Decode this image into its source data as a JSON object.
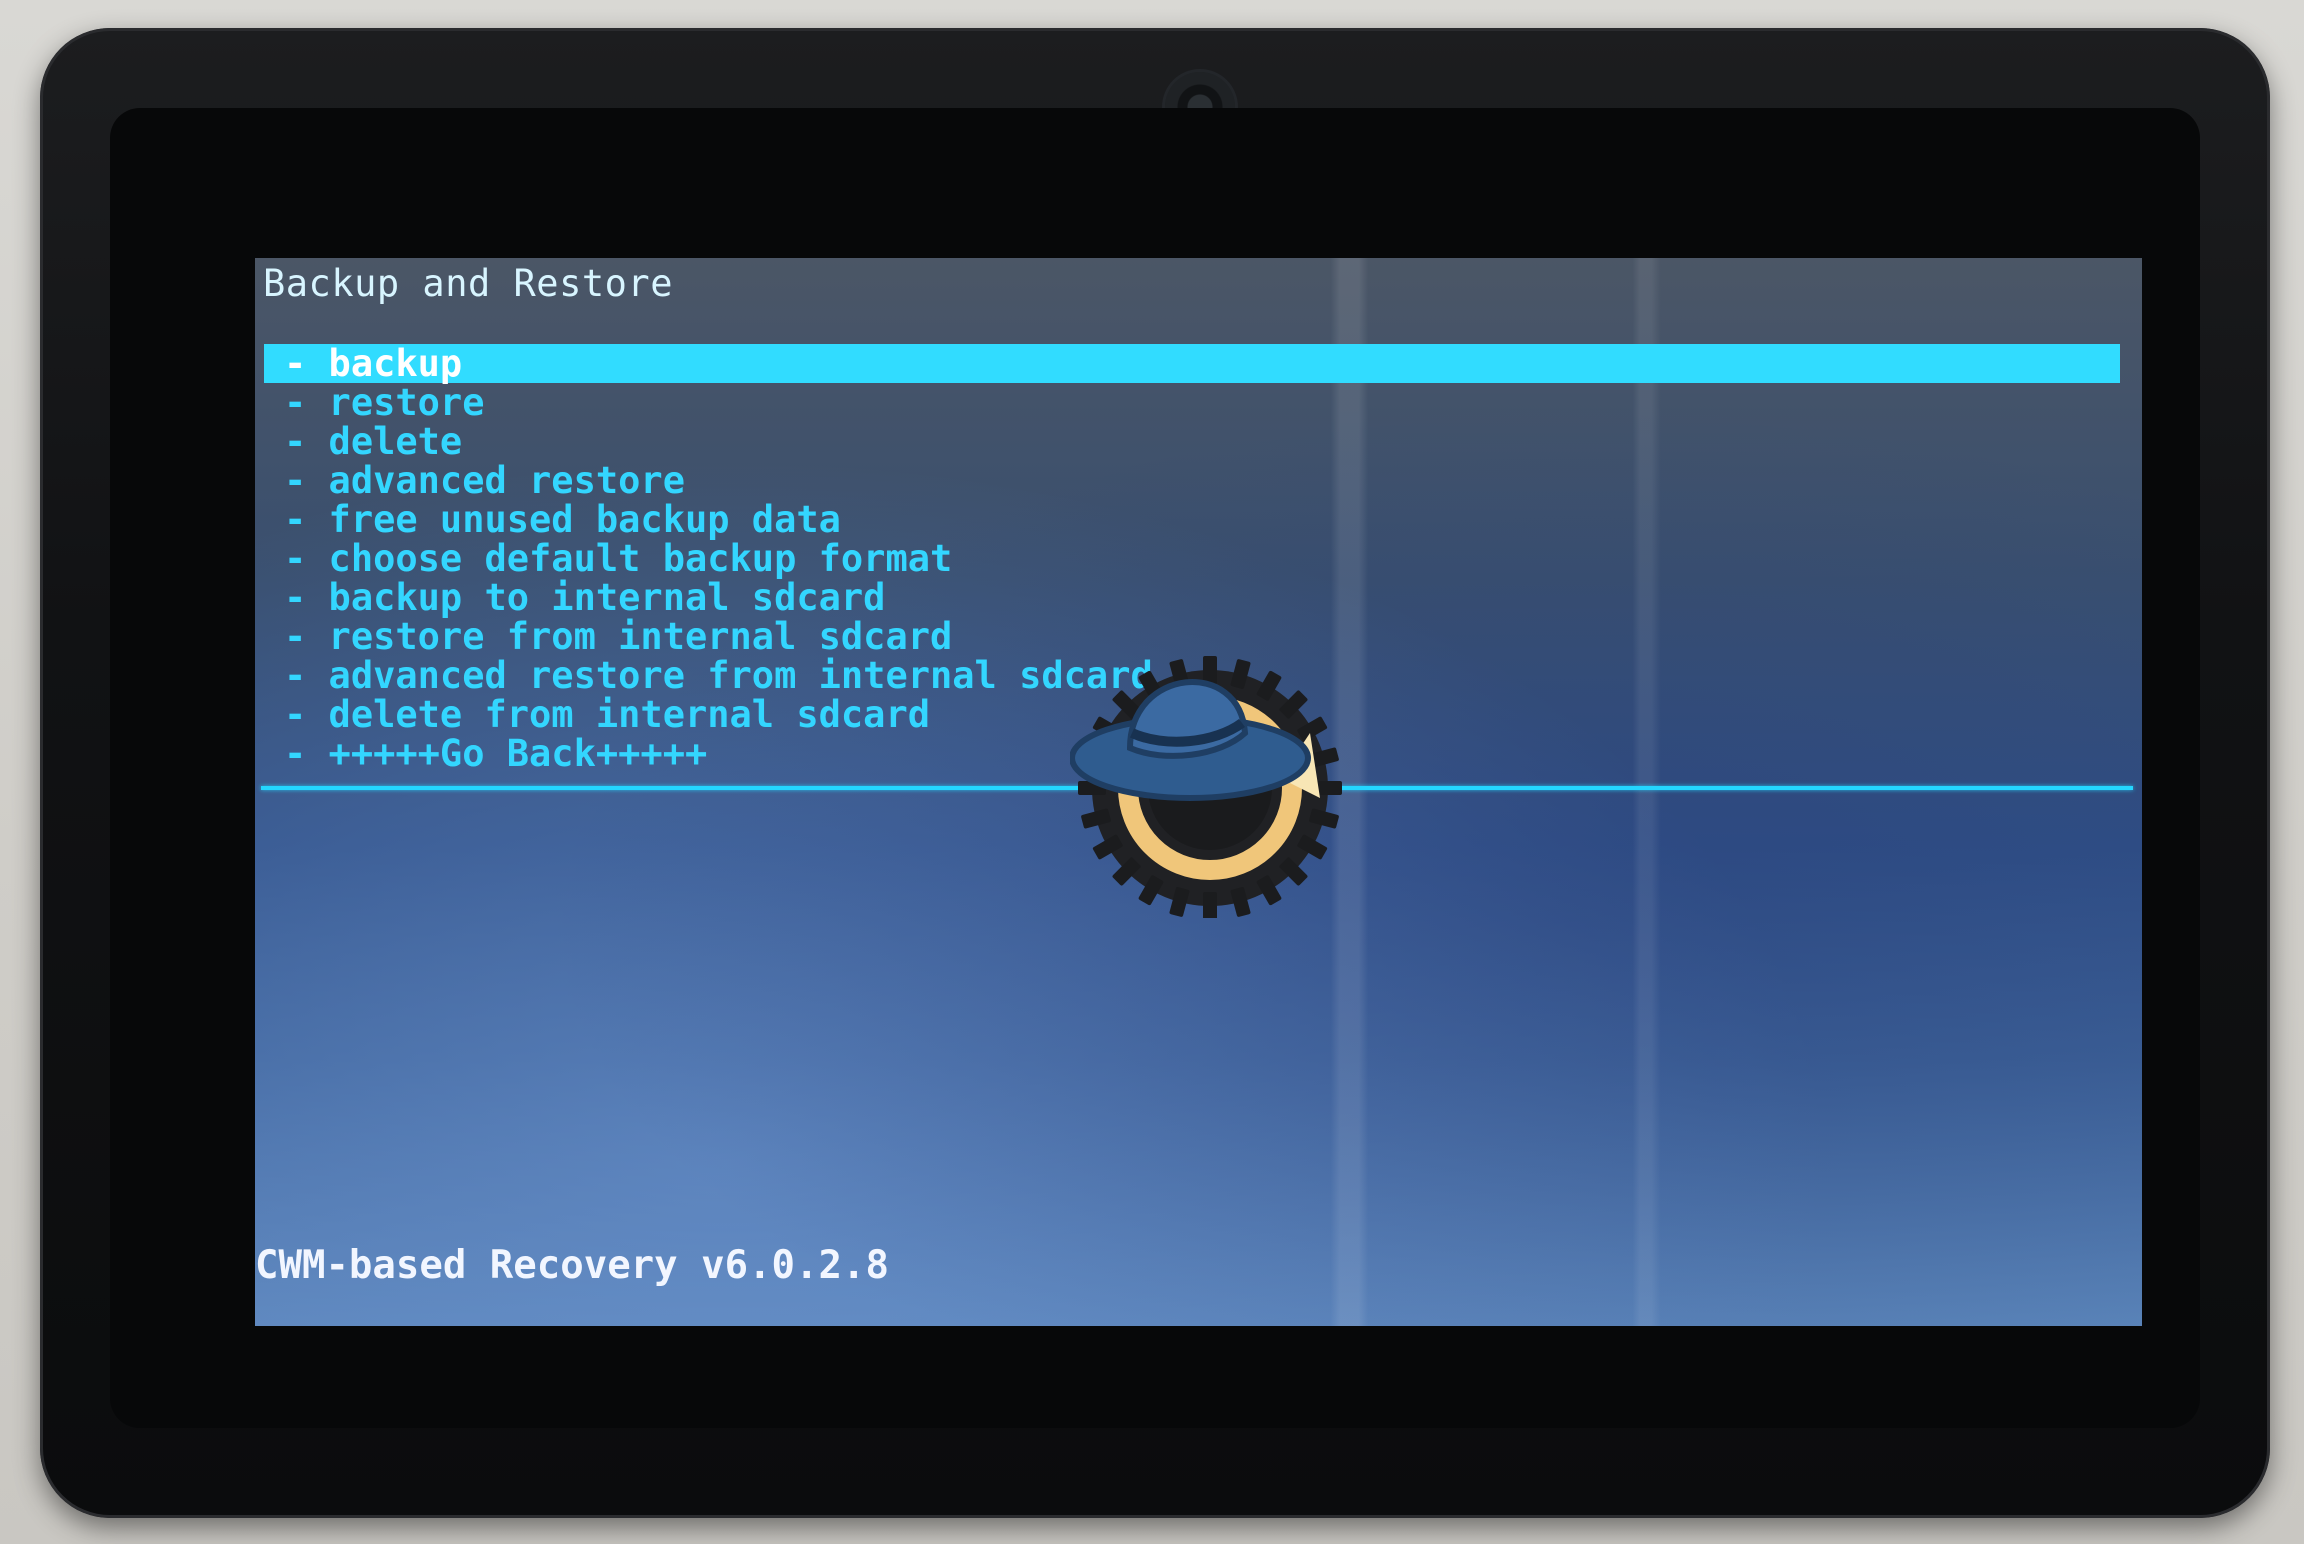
{
  "recovery": {
    "header": "Backup and Restore",
    "menu": [
      {
        "label": "- backup",
        "selected": true
      },
      {
        "label": "- restore",
        "selected": false
      },
      {
        "label": "- delete",
        "selected": false
      },
      {
        "label": "- advanced restore",
        "selected": false
      },
      {
        "label": "- free unused backup data",
        "selected": false
      },
      {
        "label": "- choose default backup format",
        "selected": false
      },
      {
        "label": "- backup to internal sdcard",
        "selected": false
      },
      {
        "label": "- restore from internal sdcard",
        "selected": false
      },
      {
        "label": "- advanced restore from internal sdcard",
        "selected": false
      },
      {
        "label": "- delete from internal sdcard",
        "selected": false
      },
      {
        "label": "- +++++Go Back+++++",
        "selected": false
      }
    ],
    "footer": "CWM-based Recovery v6.0.2.8"
  },
  "colors": {
    "accent": "#31dcff",
    "text_dim": "#33d6ff",
    "header_text": "#d8f5ff",
    "footer_text": "#f2f6ff"
  },
  "icons": {
    "logo": "clockworkmod-hat-gear-icon",
    "camera": "front-camera-icon"
  }
}
